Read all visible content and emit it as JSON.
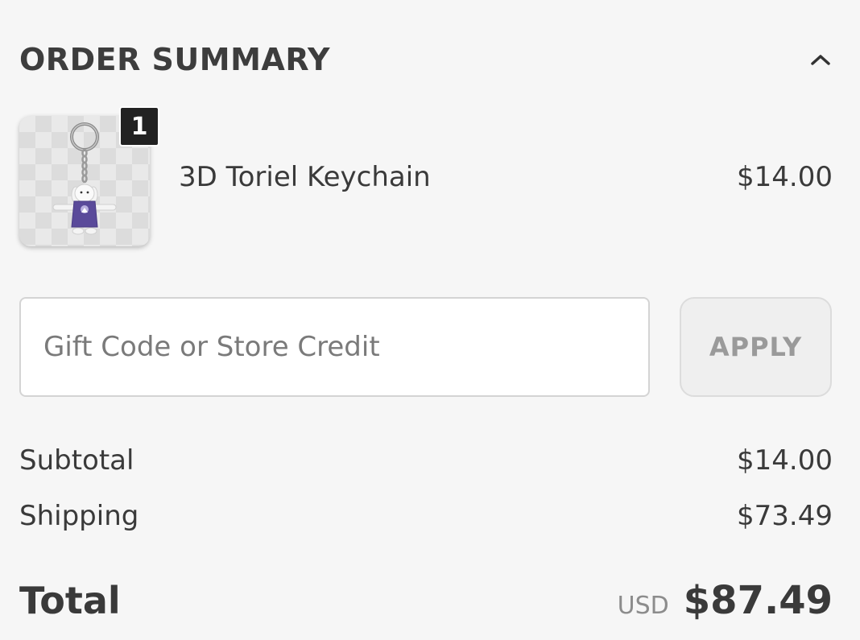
{
  "summary": {
    "title": "ORDER SUMMARY",
    "collapse_icon": "chevron-up-icon"
  },
  "item": {
    "name": "3D Toriel Keychain",
    "price": "$14.00",
    "quantity": "1",
    "image_icon": "keychain-product-image"
  },
  "discount": {
    "placeholder": "Gift Code or Store Credit",
    "value": "",
    "apply_label": "APPLY"
  },
  "totals": {
    "subtotal_label": "Subtotal",
    "subtotal_value": "$14.00",
    "shipping_label": "Shipping",
    "shipping_value": "$73.49",
    "total_label": "Total",
    "currency": "USD",
    "total_value": "$87.49"
  },
  "colors": {
    "background": "#f6f6f6",
    "text": "#3a3a3a",
    "badge": "#222222",
    "apply_text": "#9a9a9a",
    "toriel_robe": "#5a4a9a"
  }
}
